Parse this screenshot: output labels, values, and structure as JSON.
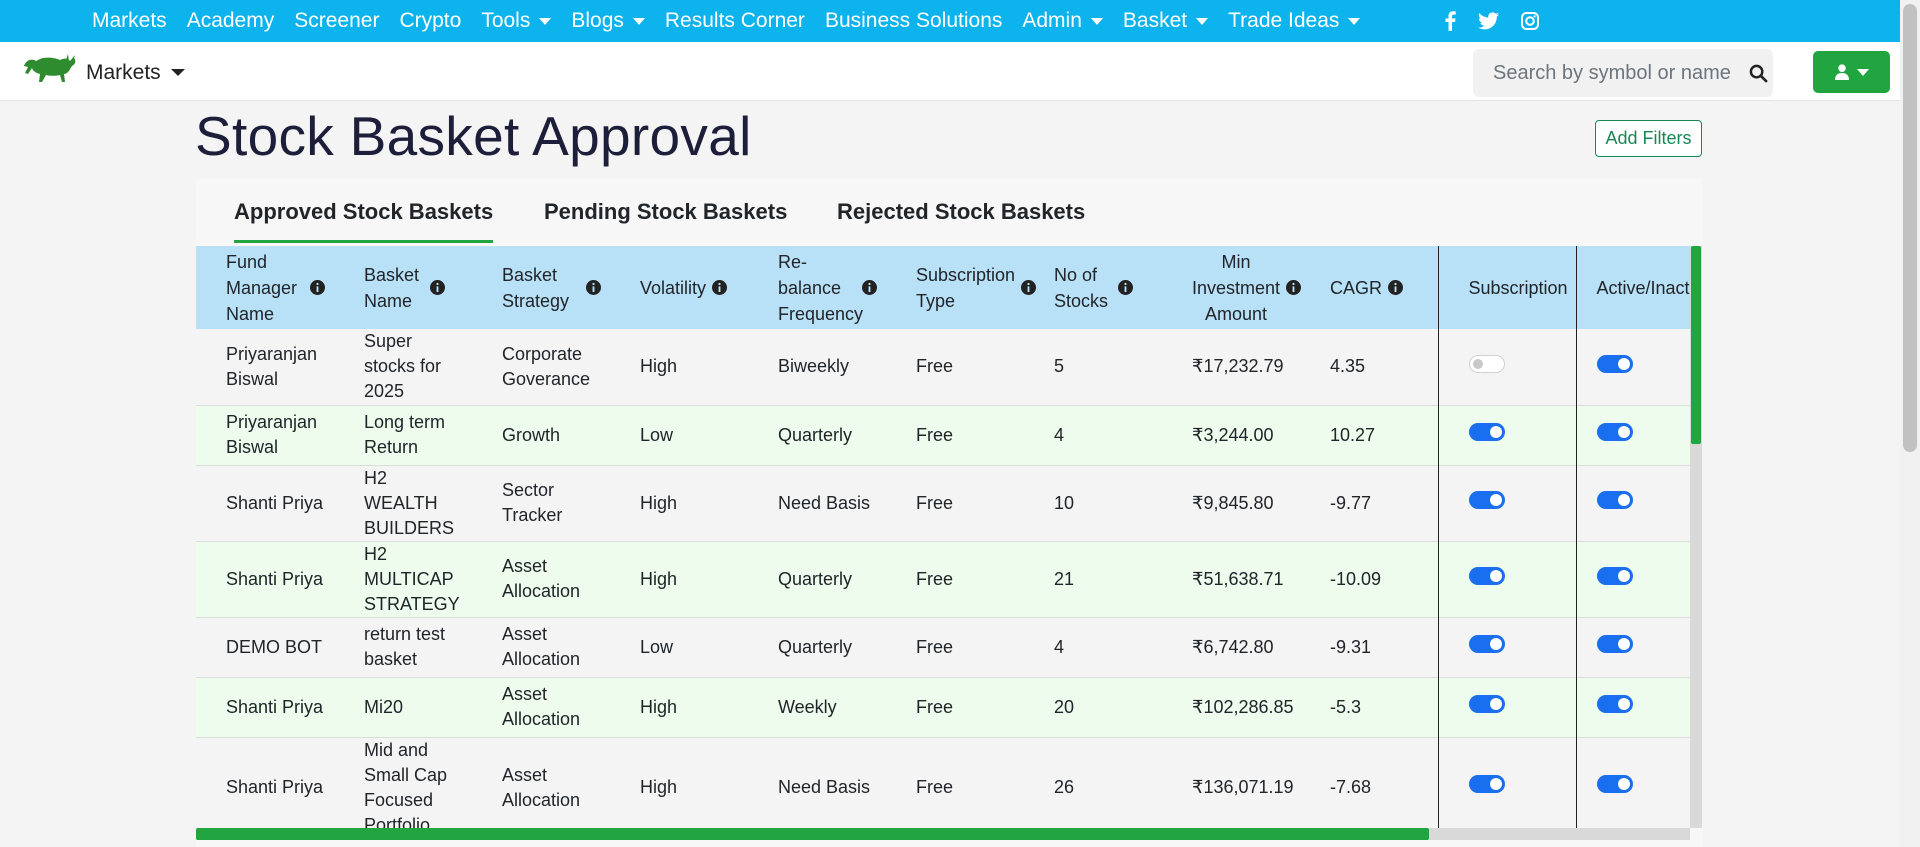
{
  "topnav": {
    "items": [
      {
        "label": "Markets",
        "dropdown": false
      },
      {
        "label": "Academy",
        "dropdown": false
      },
      {
        "label": "Screener",
        "dropdown": false
      },
      {
        "label": "Crypto",
        "dropdown": false
      },
      {
        "label": "Tools",
        "dropdown": true
      },
      {
        "label": "Blogs",
        "dropdown": true
      },
      {
        "label": "Results Corner",
        "dropdown": false
      },
      {
        "label": "Business Solutions",
        "dropdown": false
      },
      {
        "label": "Admin",
        "dropdown": true
      },
      {
        "label": "Basket",
        "dropdown": true
      },
      {
        "label": "Trade Ideas",
        "dropdown": true
      }
    ],
    "social_icons": [
      "facebook-icon",
      "twitter-icon",
      "instagram-icon"
    ],
    "background_color": "#0db3ec"
  },
  "header": {
    "brand_label": "Markets",
    "search_placeholder": "Search by symbol or name",
    "accent_color": "#21a540"
  },
  "page": {
    "title": "Stock Basket Approval",
    "add_filters_label": "Add Filters"
  },
  "tabs": [
    {
      "label": "Approved Stock Baskets",
      "active": true
    },
    {
      "label": "Pending Stock Baskets",
      "active": false
    },
    {
      "label": "Rejected Stock Baskets",
      "active": false
    }
  ],
  "table": {
    "columns": [
      {
        "label": "Fund Manager Name",
        "info": true
      },
      {
        "label": "Basket Name",
        "info": true
      },
      {
        "label": "Basket Strategy",
        "info": true
      },
      {
        "label": "Volatility",
        "info": true
      },
      {
        "label": "Re-balance Frequency",
        "info": true
      },
      {
        "label": "Subscription Type",
        "info": true
      },
      {
        "label": "No of Stocks",
        "info": true
      },
      {
        "label": "Min Investment Amount",
        "info": true
      },
      {
        "label": "CAGR",
        "info": true
      },
      {
        "label": "Subscription",
        "info": false
      },
      {
        "label": "Active/Inactive",
        "info": false
      }
    ],
    "rows": [
      {
        "manager": "Priyaranjan Biswal",
        "basket": "Super stocks for 2025",
        "strategy": "Corporate Goverance",
        "volatility": "High",
        "frequency": "Biweekly",
        "type": "Free",
        "stocks": "5",
        "min_investment": "₹17,232.79",
        "cagr": "4.35",
        "subscription": false,
        "active": true
      },
      {
        "manager": "Priyaranjan Biswal",
        "basket": "Long term Return",
        "strategy": "Growth",
        "volatility": "Low",
        "frequency": "Quarterly",
        "type": "Free",
        "stocks": "4",
        "min_investment": "₹3,244.00",
        "cagr": "10.27",
        "subscription": true,
        "active": true
      },
      {
        "manager": "Shanti Priya",
        "basket": "H2 WEALTH BUILDERS",
        "strategy": "Sector Tracker",
        "volatility": "High",
        "frequency": "Need Basis",
        "type": "Free",
        "stocks": "10",
        "min_investment": "₹9,845.80",
        "cagr": "-9.77",
        "subscription": true,
        "active": true
      },
      {
        "manager": "Shanti Priya",
        "basket": "H2 MULTICAP STRATEGY",
        "strategy": "Asset Allocation",
        "volatility": "High",
        "frequency": "Quarterly",
        "type": "Free",
        "stocks": "21",
        "min_investment": "₹51,638.71",
        "cagr": "-10.09",
        "subscription": true,
        "active": true
      },
      {
        "manager": "DEMO BOT",
        "basket": "return test basket",
        "strategy": "Asset Allocation",
        "volatility": "Low",
        "frequency": "Quarterly",
        "type": "Free",
        "stocks": "4",
        "min_investment": "₹6,742.80",
        "cagr": "-9.31",
        "subscription": true,
        "active": true
      },
      {
        "manager": "Shanti Priya",
        "basket": "Mi20",
        "strategy": "Asset Allocation",
        "volatility": "High",
        "frequency": "Weekly",
        "type": "Free",
        "stocks": "20",
        "min_investment": "₹102,286.85",
        "cagr": "-5.3",
        "subscription": true,
        "active": true
      },
      {
        "manager": "Shanti Priya",
        "basket": "Mid and Small Cap Focused Portfolio",
        "strategy": "Asset Allocation",
        "volatility": "High",
        "frequency": "Need Basis",
        "type": "Free",
        "stocks": "26",
        "min_investment": "₹136,071.19",
        "cagr": "-7.68",
        "subscription": true,
        "active": true
      }
    ]
  }
}
